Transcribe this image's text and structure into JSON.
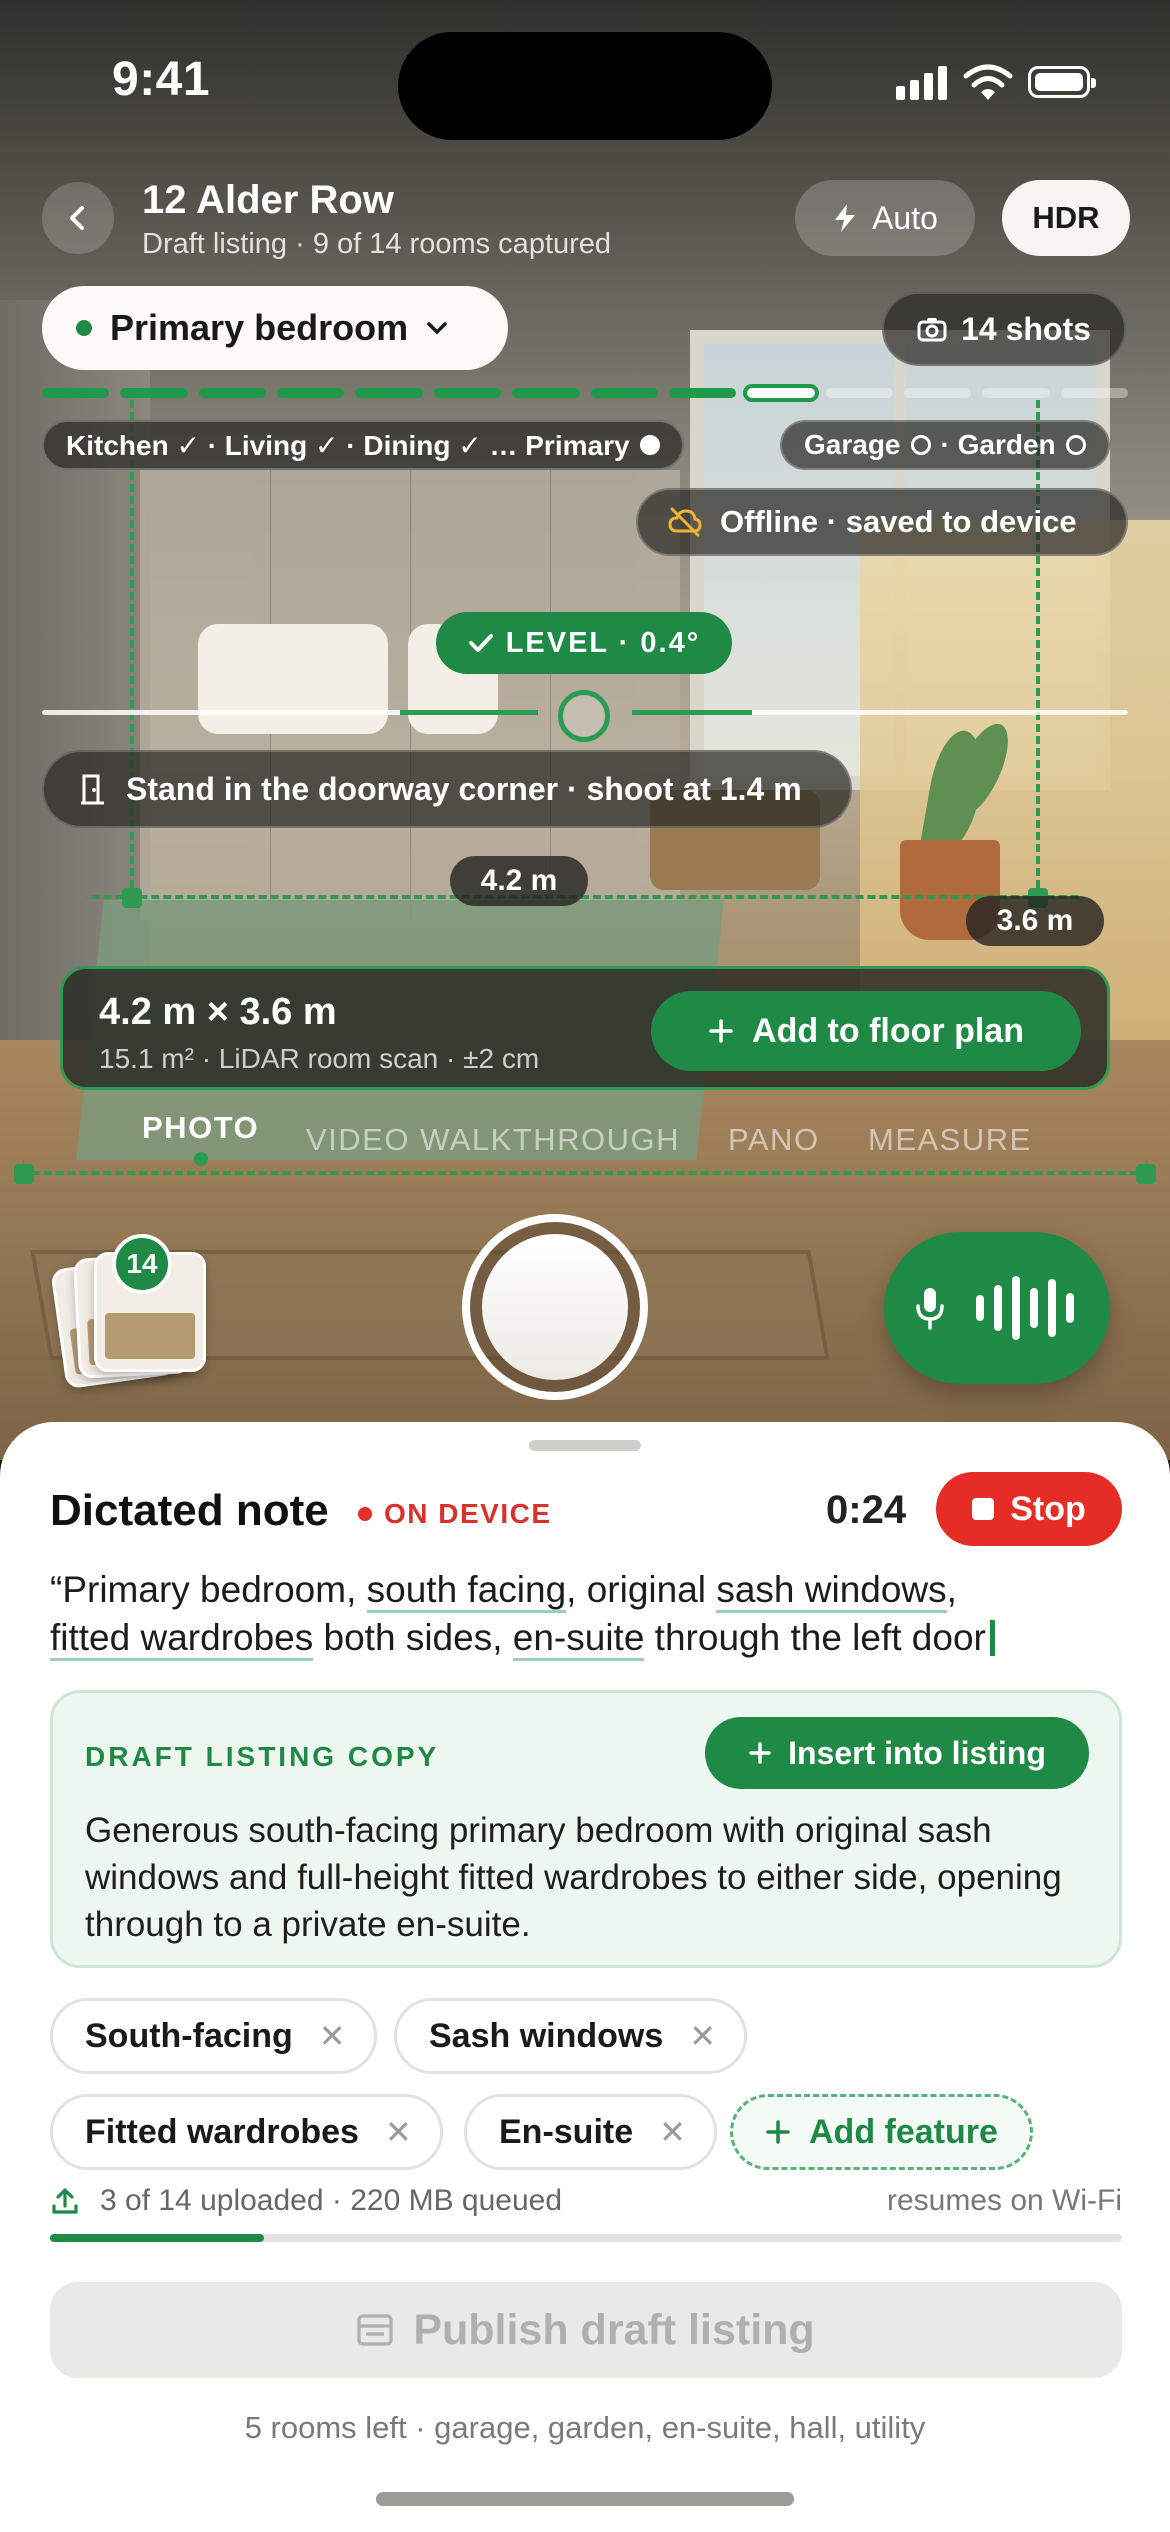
{
  "status_bar": {
    "time": "9:41"
  },
  "header": {
    "title": "12 Alder Row",
    "subtitle": "Draft listing · 9 of 14 rooms captured",
    "flash_label": "Auto",
    "hdr_label": "HDR"
  },
  "room_selector": {
    "label": "Primary bedroom"
  },
  "shots": {
    "label": "14 shots"
  },
  "progress": {
    "total_rooms": 14,
    "captured": 9,
    "current_index": 9
  },
  "rooms": {
    "done_text": "Kitchen ✓ · Living ✓ · Dining ✓ … Primary",
    "remaining_text": "Garage",
    "remaining_text_2": "· Garden"
  },
  "offline": {
    "label": "Offline · saved to device"
  },
  "level": {
    "label": "LEVEL · 0.4°",
    "value_deg": 0.4
  },
  "hint": {
    "label": "Stand in the doorway corner · shoot at 1.4 m"
  },
  "measure": {
    "width_tag": "4.2 m",
    "depth_tag": "3.6 m",
    "dims": "4.2 m × 3.6 m",
    "meta": "15.1 m² · LiDAR room scan · ±2 cm",
    "add_label": "Add to floor plan"
  },
  "modes": [
    "PHOTO",
    "VIDEO WALKTHROUGH",
    "PANO",
    "MEASURE"
  ],
  "active_mode": "PHOTO",
  "gallery": {
    "count": "14"
  },
  "note": {
    "title": "Dictated note",
    "badge": "ON DEVICE",
    "timer": "0:24",
    "stop_label": "Stop",
    "t1": "“Primary bedroom, ",
    "t2": "south facing",
    "t3": ", original ",
    "t4": "sash windows",
    "t5": ",",
    "t6": "fitted wardrobes",
    "t7": " both sides, ",
    "t8": "en-suite",
    "t9": " through the left door"
  },
  "draft": {
    "label": "DRAFT LISTING COPY",
    "insert_label": "Insert into listing",
    "body": "Generous south-facing primary bedroom with original sash windows and full-height fitted wardrobes to either side, opening through to a private en-suite."
  },
  "features": [
    "South-facing",
    "Sash windows",
    "Fitted wardrobes",
    "En-suite"
  ],
  "add_feature_label": "Add feature",
  "upload": {
    "status": "3 of 14 uploaded · 220 MB queued",
    "note": "resumes on Wi-Fi",
    "progress": 0.2
  },
  "publish": {
    "label": "Publish draft listing",
    "footnote": "5 rooms left · garage, garden, en-suite, hall, utility"
  },
  "colors": {
    "accent": "#1f8a45",
    "danger": "#e52d25"
  }
}
